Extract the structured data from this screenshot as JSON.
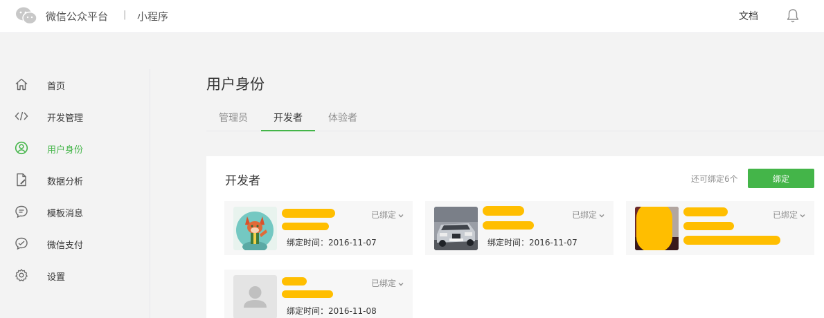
{
  "header": {
    "brand": "微信公众平台",
    "separator": "|",
    "product": "小程序",
    "doc_link": "文档",
    "icons": [
      "wechat-logo-icon",
      "bell-icon"
    ]
  },
  "sidebar": {
    "items": [
      {
        "label": "首页",
        "icon": "home-icon"
      },
      {
        "label": "开发管理",
        "icon": "code-icon"
      },
      {
        "label": "用户身份",
        "icon": "user-circle-icon",
        "active": true
      },
      {
        "label": "数据分析",
        "icon": "document-chart-icon"
      },
      {
        "label": "模板消息",
        "icon": "message-bubble-icon"
      },
      {
        "label": "微信支付",
        "icon": "payment-icon"
      },
      {
        "label": "设置",
        "icon": "gear-icon"
      }
    ],
    "active_color": "#44b549"
  },
  "main": {
    "title": "用户身份",
    "tabs": [
      {
        "label": "管理员"
      },
      {
        "label": "开发者",
        "active": true
      },
      {
        "label": "体验者"
      }
    ],
    "panel": {
      "title": "开发者",
      "remaining_text": "还可绑定6个",
      "bind_button": "绑定",
      "members": [
        {
          "status": "已绑定",
          "bind_time": "绑定时间：2016-11-07",
          "avatar": "cartoon-fox-avatar"
        },
        {
          "status": "已绑定",
          "bind_time": "绑定时间：2016-11-07",
          "avatar": "car-photo-avatar"
        },
        {
          "status": "已绑定",
          "bind_time": "",
          "avatar": "photo-avatar"
        },
        {
          "status": "已绑定",
          "bind_time": "绑定时间：2016-11-08",
          "avatar": "default-person-avatar"
        }
      ]
    }
  },
  "colors": {
    "accent": "#44b549",
    "redaction": "#ffbe00"
  }
}
